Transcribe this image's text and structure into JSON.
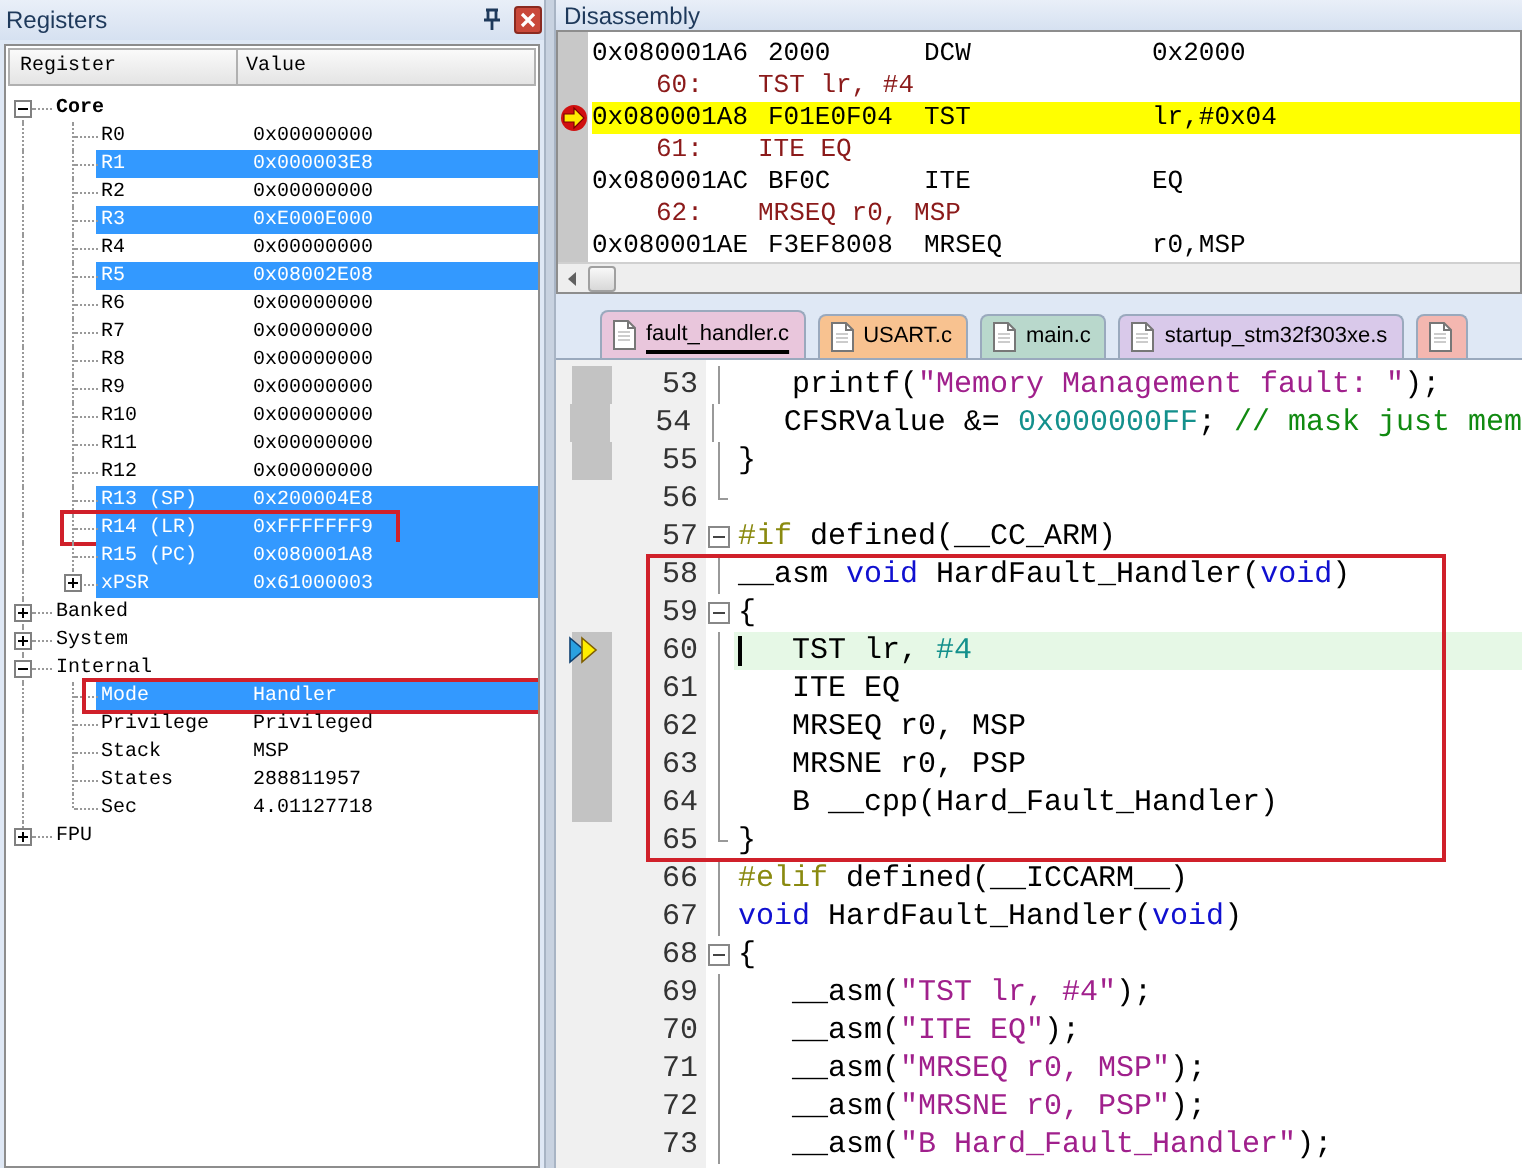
{
  "registers": {
    "title": "Registers",
    "columns": [
      "Register",
      "Value"
    ],
    "tree": [
      {
        "name": "Core",
        "bold": true,
        "expanded": true,
        "children": [
          {
            "name": "R0",
            "value": "0x00000000",
            "kind": "value",
            "highlighted": false,
            "marked": false
          },
          {
            "name": "R1",
            "value": "0x000003E8",
            "kind": "value",
            "highlighted": true,
            "marked": false
          },
          {
            "name": "R2",
            "value": "0x00000000",
            "kind": "value",
            "highlighted": false,
            "marked": false
          },
          {
            "name": "R3",
            "value": "0xE000E000",
            "kind": "value",
            "highlighted": true,
            "marked": false
          },
          {
            "name": "R4",
            "value": "0x00000000",
            "kind": "value",
            "highlighted": false,
            "marked": false
          },
          {
            "name": "R5",
            "value": "0x08002E08",
            "kind": "value",
            "highlighted": true,
            "marked": false
          },
          {
            "name": "R6",
            "value": "0x00000000",
            "kind": "value",
            "highlighted": false,
            "marked": false
          },
          {
            "name": "R7",
            "value": "0x00000000",
            "kind": "value",
            "highlighted": false,
            "marked": false
          },
          {
            "name": "R8",
            "value": "0x00000000",
            "kind": "value",
            "highlighted": false,
            "marked": false
          },
          {
            "name": "R9",
            "value": "0x00000000",
            "kind": "value",
            "highlighted": false,
            "marked": false
          },
          {
            "name": "R10",
            "value": "0x00000000",
            "kind": "value",
            "highlighted": false,
            "marked": false
          },
          {
            "name": "R11",
            "value": "0x00000000",
            "kind": "value",
            "highlighted": false,
            "marked": false
          },
          {
            "name": "R12",
            "value": "0x00000000",
            "kind": "value",
            "highlighted": false,
            "marked": false
          },
          {
            "name": "R13 (SP)",
            "value": "0x200004E8",
            "kind": "value",
            "highlighted": true,
            "marked": false
          },
          {
            "name": "R14 (LR)",
            "value": "0xFFFFFFF9",
            "kind": "value",
            "highlighted": true,
            "marked": true
          },
          {
            "name": "R15 (PC)",
            "value": "0x080001A8",
            "kind": "value",
            "highlighted": true,
            "marked": false
          },
          {
            "name": "xPSR",
            "value": "0x61000003",
            "kind": "group",
            "expanded": false,
            "highlighted": true,
            "marked": false
          }
        ]
      },
      {
        "name": "Banked",
        "bold": false,
        "expanded": false
      },
      {
        "name": "System",
        "bold": false,
        "expanded": false
      },
      {
        "name": "Internal",
        "bold": false,
        "expanded": true,
        "children": [
          {
            "name": "Mode",
            "value": "Handler",
            "kind": "value",
            "highlighted": true,
            "marked": true
          },
          {
            "name": "Privilege",
            "value": "Privileged",
            "kind": "value",
            "highlighted": false,
            "marked": false
          },
          {
            "name": "Stack",
            "value": "MSP",
            "kind": "value",
            "highlighted": false,
            "marked": false
          },
          {
            "name": "States",
            "value": "288811957",
            "kind": "value",
            "highlighted": false,
            "marked": false
          },
          {
            "name": "Sec",
            "value": "4.01127718",
            "kind": "value",
            "highlighted": false,
            "marked": false
          }
        ]
      },
      {
        "name": "FPU",
        "bold": false,
        "expanded": false
      }
    ]
  },
  "disassembly": {
    "title": "Disassembly",
    "lines": [
      {
        "kind": "instr",
        "address": "0x080001A6",
        "opcode": "2000",
        "mnemonic": "DCW",
        "operands": "0x2000",
        "current": false
      },
      {
        "kind": "source",
        "line": "60:",
        "text": "TST lr, #4",
        "current": false
      },
      {
        "kind": "instr",
        "address": "0x080001A8",
        "opcode": "F01E0F04",
        "mnemonic": "TST",
        "operands": "lr,#0x04",
        "current": true
      },
      {
        "kind": "source",
        "line": "61:",
        "text": "ITE EQ",
        "current": false
      },
      {
        "kind": "instr",
        "address": "0x080001AC",
        "opcode": "BF0C",
        "mnemonic": "ITE",
        "operands": "EQ",
        "current": false
      },
      {
        "kind": "source",
        "line": "62:",
        "text": "MRSEQ r0, MSP",
        "current": false
      },
      {
        "kind": "instr",
        "address": "0x080001AE",
        "opcode": "F3EF8008",
        "mnemonic": "MRSEQ",
        "operands": "r0,MSP",
        "current": false
      }
    ]
  },
  "editor": {
    "tabs": [
      {
        "label": "fault_handler.c",
        "selected": true,
        "color": "#e9c6dc"
      },
      {
        "label": "USART.c",
        "selected": false,
        "color": "#f8c290"
      },
      {
        "label": "main.c",
        "selected": false,
        "color": "#b9d8cc"
      },
      {
        "label": "startup_stm32f303xe.s",
        "selected": false,
        "color": "#d9c9ea"
      },
      {
        "selected": false,
        "color": "#f4b7b0"
      }
    ],
    "lines": [
      {
        "number": "53",
        "executed": true,
        "current": false,
        "boxed": false,
        "fold_start": false,
        "fold_end": false,
        "tokens": [
          {
            "t": "   printf(",
            "kind": "plain"
          },
          {
            "t": "\"Memory Management fault: \"",
            "kind": "str"
          },
          {
            "t": ");",
            "kind": "plain"
          }
        ]
      },
      {
        "number": "54",
        "executed": true,
        "current": false,
        "boxed": false,
        "fold_start": false,
        "fold_end": false,
        "tokens": [
          {
            "t": "   CFSRValue &= ",
            "kind": "plain"
          },
          {
            "t": "0x000000FF",
            "kind": "num"
          },
          {
            "t": "; ",
            "kind": "plain"
          },
          {
            "t": "// mask just mem",
            "kind": "cmt"
          }
        ]
      },
      {
        "number": "55",
        "executed": true,
        "current": false,
        "boxed": false,
        "fold_start": false,
        "fold_end": false,
        "tokens": [
          {
            "t": "}",
            "kind": "plain"
          }
        ]
      },
      {
        "number": "56",
        "executed": false,
        "current": false,
        "boxed": false,
        "fold_start": false,
        "fold_end": true
      },
      {
        "number": "57",
        "executed": false,
        "current": false,
        "boxed": false,
        "fold_start": true,
        "fold_end": false,
        "tokens": [
          {
            "t": "#if",
            "kind": "pp"
          },
          {
            "t": " defined(__CC_ARM)",
            "kind": "plain"
          }
        ]
      },
      {
        "number": "58",
        "executed": false,
        "current": false,
        "boxed": true,
        "fold_start": false,
        "fold_end": false,
        "tokens": [
          {
            "t": "__asm ",
            "kind": "plain"
          },
          {
            "t": "void",
            "kind": "kw"
          },
          {
            "t": " HardFault_Handler(",
            "kind": "plain"
          },
          {
            "t": "void",
            "kind": "kw"
          },
          {
            "t": ")",
            "kind": "plain"
          }
        ]
      },
      {
        "number": "59",
        "executed": false,
        "current": false,
        "boxed": true,
        "fold_start": true,
        "fold_end": false,
        "tokens": [
          {
            "t": "{",
            "kind": "plain"
          }
        ]
      },
      {
        "number": "60",
        "executed": true,
        "current": true,
        "boxed": true,
        "fold_start": false,
        "fold_end": false,
        "tokens": [
          {
            "t": "   TST lr, ",
            "kind": "plain"
          },
          {
            "t": "#4",
            "kind": "num"
          }
        ]
      },
      {
        "number": "61",
        "executed": true,
        "current": false,
        "boxed": true,
        "fold_start": false,
        "fold_end": false,
        "tokens": [
          {
            "t": "   ITE EQ",
            "kind": "plain"
          }
        ]
      },
      {
        "number": "62",
        "executed": true,
        "current": false,
        "boxed": true,
        "fold_start": false,
        "fold_end": false,
        "tokens": [
          {
            "t": "   MRSEQ r0, MSP",
            "kind": "plain"
          }
        ]
      },
      {
        "number": "63",
        "executed": true,
        "current": false,
        "boxed": true,
        "fold_start": false,
        "fold_end": false,
        "tokens": [
          {
            "t": "   MRSNE r0, PSP",
            "kind": "plain"
          }
        ]
      },
      {
        "number": "64",
        "executed": true,
        "current": false,
        "boxed": true,
        "fold_start": false,
        "fold_end": false,
        "tokens": [
          {
            "t": "   B __cpp(Hard_Fault_Handler)",
            "kind": "plain"
          }
        ]
      },
      {
        "number": "65",
        "executed": false,
        "current": false,
        "boxed": true,
        "fold_start": false,
        "fold_end": true,
        "tokens": [
          {
            "t": "}",
            "kind": "plain"
          }
        ]
      },
      {
        "number": "66",
        "executed": false,
        "current": false,
        "boxed": false,
        "fold_start": false,
        "fold_end": false,
        "tokens": [
          {
            "t": "#elif",
            "kind": "pp"
          },
          {
            "t": " defined(__ICCARM__)",
            "kind": "plain"
          }
        ]
      },
      {
        "number": "67",
        "executed": false,
        "current": false,
        "boxed": false,
        "fold_start": false,
        "fold_end": false,
        "tokens": [
          {
            "t": "void",
            "kind": "kw"
          },
          {
            "t": " HardFault_Handler(",
            "kind": "plain"
          },
          {
            "t": "void",
            "kind": "kw"
          },
          {
            "t": ")",
            "kind": "plain"
          }
        ]
      },
      {
        "number": "68",
        "executed": false,
        "current": false,
        "boxed": false,
        "fold_start": true,
        "fold_end": false,
        "tokens": [
          {
            "t": "{",
            "kind": "plain"
          }
        ]
      },
      {
        "number": "69",
        "executed": false,
        "current": false,
        "boxed": false,
        "fold_start": false,
        "fold_end": false,
        "tokens": [
          {
            "t": "   __asm(",
            "kind": "plain"
          },
          {
            "t": "\"TST lr, #4\"",
            "kind": "str"
          },
          {
            "t": ");",
            "kind": "plain"
          }
        ]
      },
      {
        "number": "70",
        "executed": false,
        "current": false,
        "boxed": false,
        "fold_start": false,
        "fold_end": false,
        "tokens": [
          {
            "t": "   __asm(",
            "kind": "plain"
          },
          {
            "t": "\"ITE EQ\"",
            "kind": "str"
          },
          {
            "t": ");",
            "kind": "plain"
          }
        ]
      },
      {
        "number": "71",
        "executed": false,
        "current": false,
        "boxed": false,
        "fold_start": false,
        "fold_end": false,
        "tokens": [
          {
            "t": "   __asm(",
            "kind": "plain"
          },
          {
            "t": "\"MRSEQ r0, MSP\"",
            "kind": "str"
          },
          {
            "t": ");",
            "kind": "plain"
          }
        ]
      },
      {
        "number": "72",
        "executed": false,
        "current": false,
        "boxed": false,
        "fold_start": false,
        "fold_end": false,
        "tokens": [
          {
            "t": "   __asm(",
            "kind": "plain"
          },
          {
            "t": "\"MRSNE r0, PSP\"",
            "kind": "str"
          },
          {
            "t": ");",
            "kind": "plain"
          }
        ]
      },
      {
        "number": "73",
        "executed": false,
        "current": false,
        "boxed": false,
        "fold_start": false,
        "fold_end": false,
        "tokens": [
          {
            "t": "   __asm(",
            "kind": "plain"
          },
          {
            "t": "\"B Hard_Fault_Handler\"",
            "kind": "str"
          },
          {
            "t": ");",
            "kind": "plain"
          }
        ]
      }
    ]
  }
}
